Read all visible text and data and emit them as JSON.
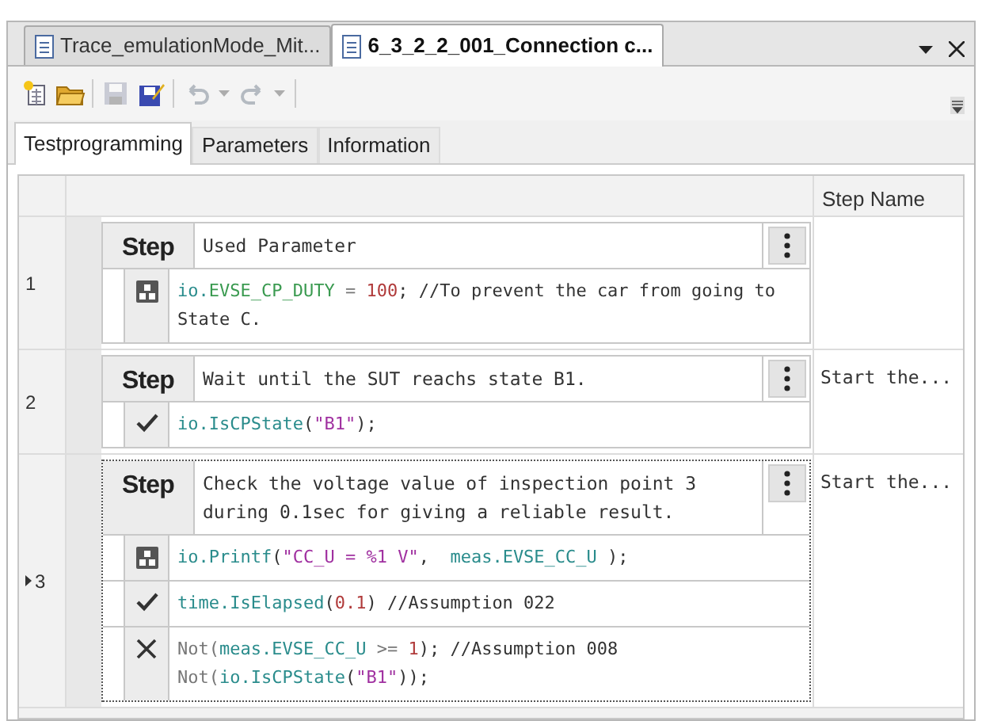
{
  "document_tabs": [
    {
      "label": "Trace_emulationMode_Mit...",
      "selected": false
    },
    {
      "label": "6_3_2_2_001_Connection c...",
      "selected": true
    }
  ],
  "toolbar": [
    {
      "kind": "new",
      "disabled": false
    },
    {
      "kind": "open",
      "disabled": false
    },
    {
      "kind": "save",
      "disabled": true
    },
    {
      "kind": "save-edit",
      "disabled": false
    },
    {
      "kind": "undo",
      "disabled": true
    },
    {
      "kind": "redo",
      "disabled": true
    }
  ],
  "view_tabs": [
    {
      "label": "Testprogramming",
      "selected": true
    },
    {
      "label": "Parameters",
      "selected": false
    },
    {
      "label": "Information",
      "selected": false
    }
  ],
  "table": {
    "step_name_header": "Step Name",
    "rows": [
      {
        "number": "1",
        "selected": false,
        "step_label": "Step",
        "description": "Used Parameter",
        "actions": [
          {
            "kind": "set",
            "code": [
              {
                "kind": "obj",
                "text": "io."
              },
              {
                "kind": "member",
                "text": "EVSE_CP_DUTY"
              },
              {
                "kind": "muted",
                "text": " = "
              },
              {
                "kind": "num",
                "text": "100"
              },
              {
                "kind": "text",
                "text": "; //To prevent the car from going to State C."
              }
            ]
          }
        ]
      },
      {
        "number": "2",
        "selected": false,
        "step_label": "Step",
        "description": "Wait until the SUT reachs state B1.",
        "step_name": "Start the...",
        "actions": [
          {
            "kind": "check",
            "code": [
              {
                "kind": "obj",
                "text": "io.IsCPState"
              },
              {
                "kind": "text",
                "text": "("
              },
              {
                "kind": "str",
                "text": "\"B1\""
              },
              {
                "kind": "text",
                "text": ");"
              }
            ]
          }
        ]
      },
      {
        "number": "3",
        "selected": true,
        "step_label": "Step",
        "description": "Check the voltage value of inspection point 3 during 0.1sec for giving a reliable result.",
        "step_name": "Start the...",
        "actions": [
          {
            "kind": "set",
            "code": [
              {
                "kind": "obj",
                "text": "io.Printf"
              },
              {
                "kind": "text",
                "text": "("
              },
              {
                "kind": "str",
                "text": "\"CC_U = %1 V\""
              },
              {
                "kind": "text",
                "text": ",  "
              },
              {
                "kind": "obj",
                "text": "meas.EVSE_CC_U"
              },
              {
                "kind": "text",
                "text": " );"
              }
            ]
          },
          {
            "kind": "check",
            "code": [
              {
                "kind": "obj",
                "text": "time.IsElapsed"
              },
              {
                "kind": "text",
                "text": "("
              },
              {
                "kind": "num",
                "text": "0.1"
              },
              {
                "kind": "text",
                "text": ") //Assumption 022"
              }
            ]
          },
          {
            "kind": "fail",
            "code": [
              {
                "kind": "muted",
                "text": "Not("
              },
              {
                "kind": "obj",
                "text": "meas.EVSE_CC_U"
              },
              {
                "kind": "muted",
                "text": " >= "
              },
              {
                "kind": "num",
                "text": "1"
              },
              {
                "kind": "text",
                "text": "); //Assumption 008\n"
              },
              {
                "kind": "muted",
                "text": "Not("
              },
              {
                "kind": "obj",
                "text": "io.IsCPState"
              },
              {
                "kind": "text",
                "text": "("
              },
              {
                "kind": "str",
                "text": "\"B1\""
              },
              {
                "kind": "text",
                "text": "));"
              }
            ]
          }
        ]
      }
    ]
  }
}
